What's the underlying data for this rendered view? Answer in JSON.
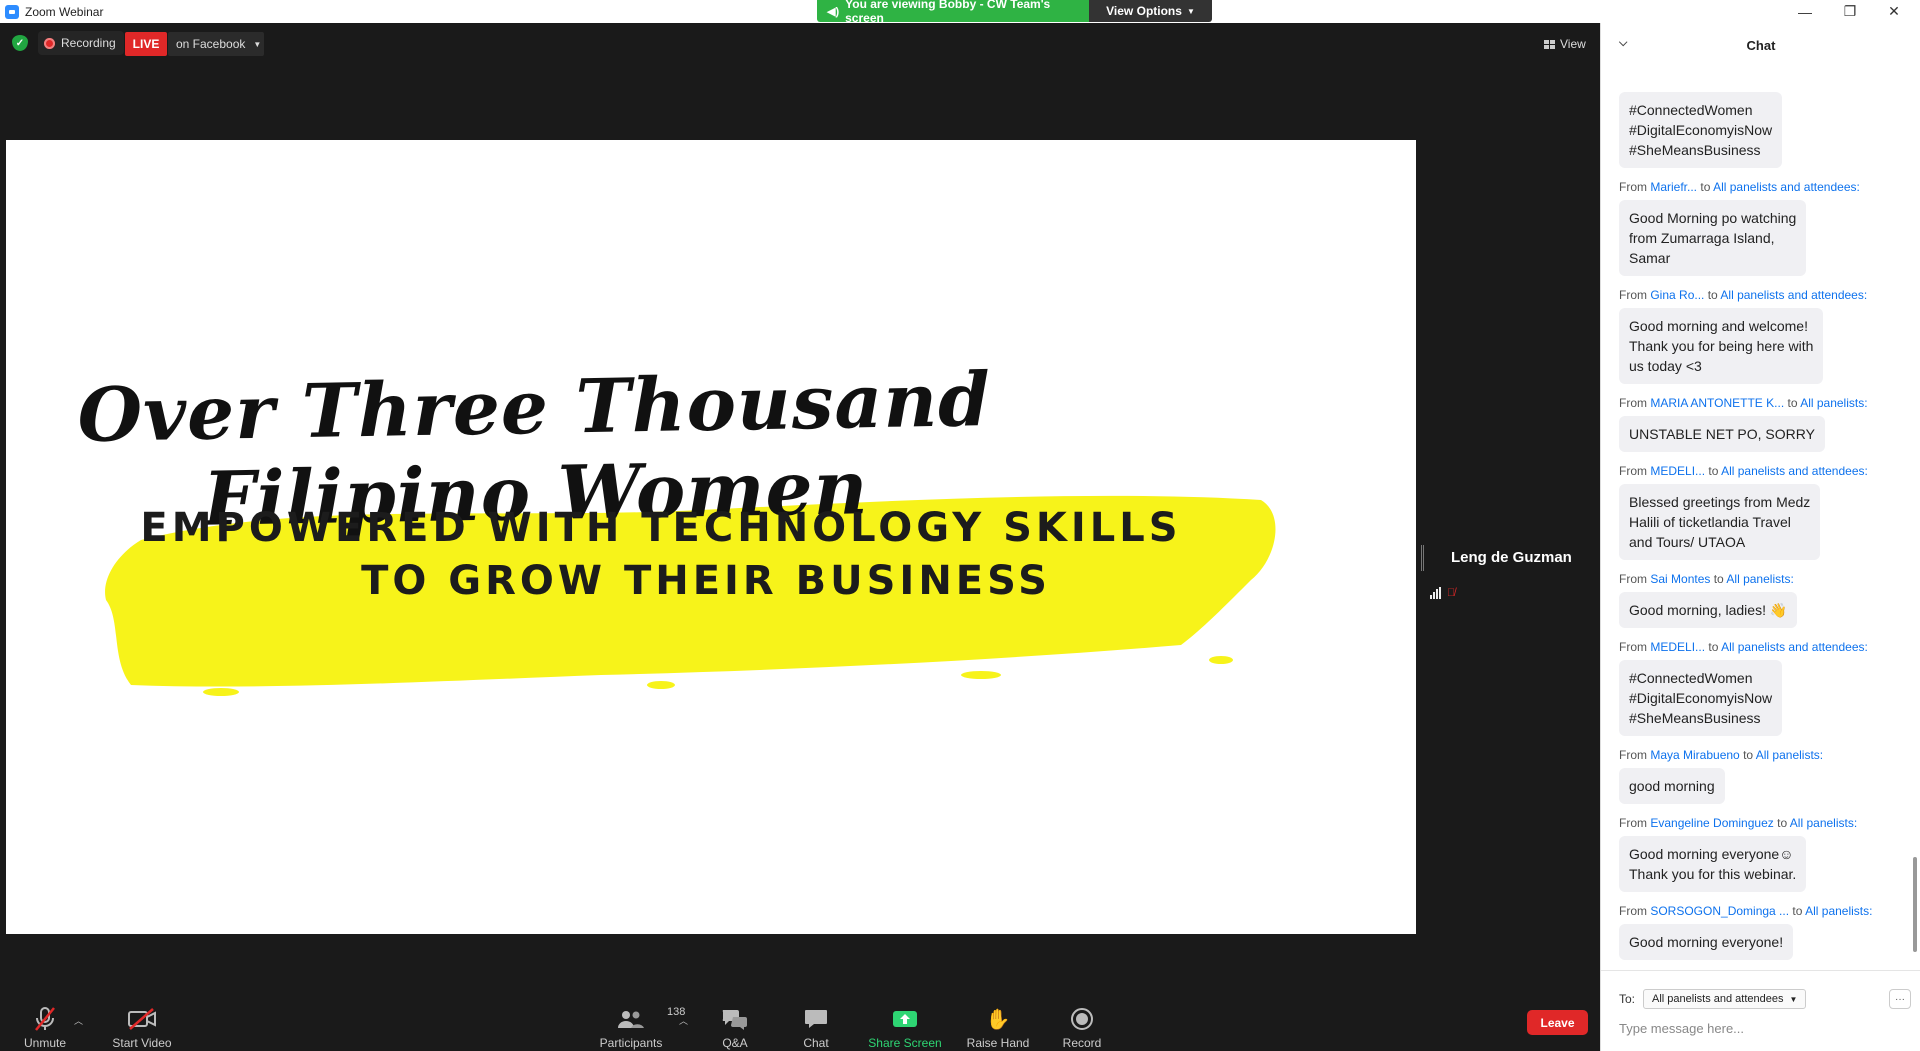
{
  "window": {
    "title": "Zoom Webinar"
  },
  "share_banner": {
    "viewing_text": "You are viewing Bobby - CW Team's screen",
    "view_options_label": "View Options"
  },
  "topbar": {
    "recording_label": "Recording",
    "live_label": "LIVE",
    "live_target": "on Facebook",
    "view_label": "View"
  },
  "slide": {
    "headline": "Over Three Thousand Filipino Women",
    "line1": "EMPOWERED WITH TECHNOLOGY SKILLS",
    "line2": "TO GROW THEIR BUSINESS",
    "highlight_color": "#f7f31a"
  },
  "speaker": {
    "name": "Leng de Guzman"
  },
  "toolbar": {
    "unmute": "Unmute",
    "start_video": "Start Video",
    "participants": "Participants",
    "participants_count": "138",
    "qa": "Q&A",
    "chat": "Chat",
    "share_screen": "Share Screen",
    "raise_hand": "Raise Hand",
    "record": "Record",
    "leave": "Leave"
  },
  "chat": {
    "title": "Chat",
    "messages": [
      {
        "from": "",
        "to": "",
        "text": "#ConnectedWomen\n    #DigitalEconomyisNow\n    #SheMeansBusiness"
      },
      {
        "from": "Mariefr...",
        "to": "All panelists and attendees:",
        "text": "Good Morning po watching\nfrom Zumarraga Island,\nSamar"
      },
      {
        "from": "Gina Ro...",
        "to": "All panelists and attendees:",
        "text": "Good morning and welcome!\nThank you for being here with\nus today <3"
      },
      {
        "from": "MARIA  ANTONETTE K...",
        "to": "All panelists:",
        "text": "UNSTABLE NET PO, SORRY"
      },
      {
        "from": "MEDELI...",
        "to": "All panelists and attendees:",
        "text": "Blessed greetings from Medz\nHalili of ticketlandia Travel\nand Tours/ UTAOA"
      },
      {
        "from": "Sai Montes",
        "to": "All panelists:",
        "text": "Good morning, ladies! 👋"
      },
      {
        "from": "MEDELI...",
        "to": "All panelists and attendees:",
        "text": "#ConnectedWomen\n    #DigitalEconomyisNow\n    #SheMeansBusiness"
      },
      {
        "from": "Maya Mirabueno",
        "to": "All panelists:",
        "text": "good morning"
      },
      {
        "from": "Evangeline Dominguez",
        "to": "All panelists:",
        "text": "Good morning everyone☺\nThank you for this webinar."
      },
      {
        "from": "SORSOGON_Dominga ...",
        "to": "All panelists:",
        "text": "Good morning everyone!"
      }
    ],
    "from_word": "From",
    "to_word": "to",
    "to_label": "To:",
    "recipient": "All panelists and attendees",
    "more": "···",
    "placeholder": "Type message here..."
  }
}
